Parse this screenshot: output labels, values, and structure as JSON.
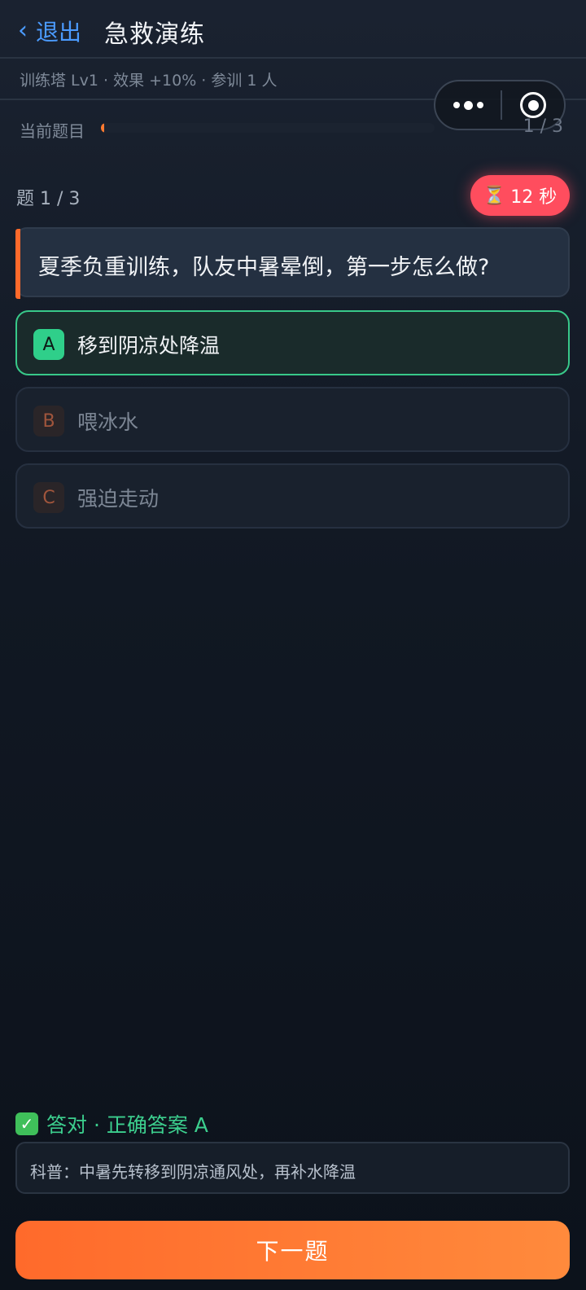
{
  "header": {
    "back_chevron": "‹",
    "back_label": "退出",
    "title": "急救演练"
  },
  "subinfo": "训练塔 Lv1 · 效果 +10% · 参训 1 人",
  "capsule": {
    "more_icon": "more-dots-icon",
    "close_icon": "target-close-icon"
  },
  "progress": {
    "label": "当前题目",
    "count": "1 / 3",
    "fraction": 0.01,
    "color": "#ff7a30"
  },
  "quiz": {
    "index": "题 1 / 3",
    "timer_icon": "⏳",
    "timer": "12 秒",
    "question": "夏季负重训练，队友中暑晕倒，第一步怎么做?",
    "options": [
      {
        "letter": "A",
        "text": "移到阴凉处降温",
        "state": "correct"
      },
      {
        "letter": "B",
        "text": "喂冰水",
        "state": "dim"
      },
      {
        "letter": "C",
        "text": "强迫走动",
        "state": "dim"
      }
    ]
  },
  "result": {
    "check": "✓",
    "text": "答对 · 正确答案 A"
  },
  "tip": "科普：中暑先转移到阴凉通风处，再补水降温",
  "next_button": "下一题",
  "colors": {
    "accent_orange": "#ff6a2b",
    "correct_green": "#38c98a",
    "timer_red": "#ff4d5e",
    "link_blue": "#4b9bff"
  }
}
